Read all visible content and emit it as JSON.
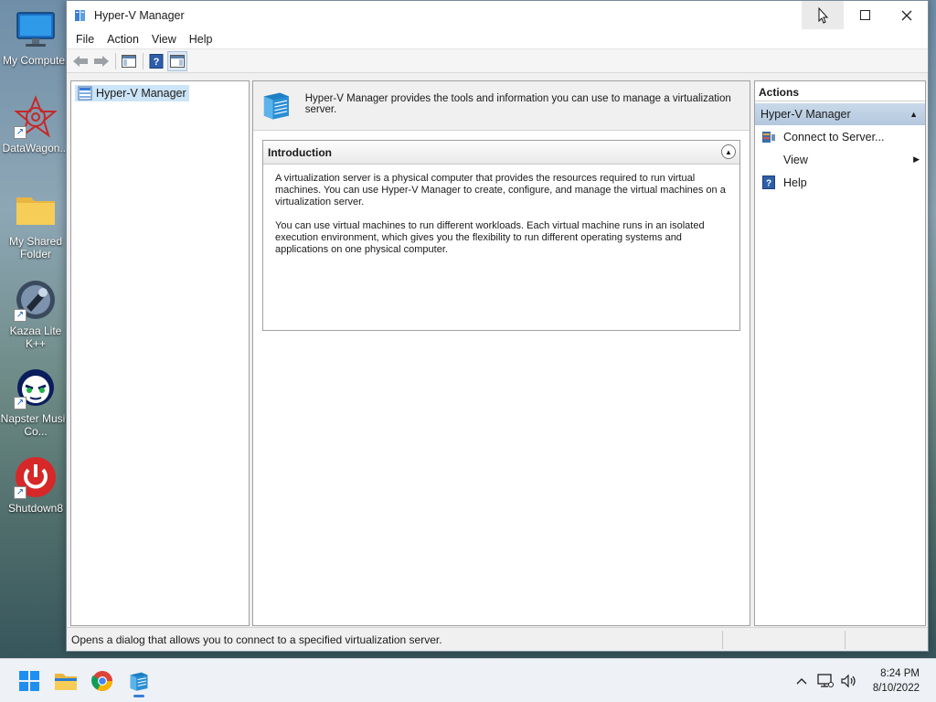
{
  "desktop": {
    "icons": [
      {
        "label": "My Computer",
        "kind": "monitor-icon"
      },
      {
        "label": "DataWagon...",
        "kind": "datawagon-icon",
        "shortcut": true
      },
      {
        "label": "My Shared Folder",
        "kind": "folder-icon"
      },
      {
        "label": "Kazaa Lite K++",
        "kind": "kazaa-icon",
        "shortcut": true
      },
      {
        "label": "Napster Music Co...",
        "kind": "napster-icon",
        "shortcut": true
      },
      {
        "label": "Shutdown8",
        "kind": "shutdown-icon",
        "shortcut": true
      }
    ]
  },
  "window": {
    "title": "Hyper-V Manager",
    "menu": [
      "File",
      "Action",
      "View",
      "Help"
    ]
  },
  "tree": {
    "root_label": "Hyper-V Manager"
  },
  "center": {
    "header_text": "Hyper-V Manager provides the tools and information you can use to manage a virtualization server.",
    "intro": {
      "title": "Introduction",
      "paragraph1": "A virtualization server is a physical computer that provides the resources required to run virtual machines. You can use Hyper-V Manager to create, configure, and manage the virtual machines on a virtualization server.",
      "paragraph2": "You can use virtual machines to run different workloads. Each virtual machine runs in an isolated execution environment, which gives you the flexibility to run different operating systems and applications on one physical computer."
    }
  },
  "actions": {
    "title": "Actions",
    "group": "Hyper-V Manager",
    "items": [
      {
        "label": "Connect to Server...",
        "icon": "connect-server-icon"
      },
      {
        "label": "View",
        "icon": "",
        "submenu": true
      },
      {
        "label": "Help",
        "icon": "help-icon"
      }
    ]
  },
  "status": {
    "text": "Opens a dialog that allows you to connect to a specified virtualization server."
  },
  "taskbar": {
    "apps": [
      "start-icon",
      "file-explorer-icon",
      "chrome-icon",
      "hyper-v-manager-icon"
    ],
    "time": "8:24 PM",
    "date": "8/10/2022"
  },
  "colors": {
    "selection": "#cce4f7",
    "action_group": "#b3c8de",
    "accent": "#3b7dd8"
  }
}
